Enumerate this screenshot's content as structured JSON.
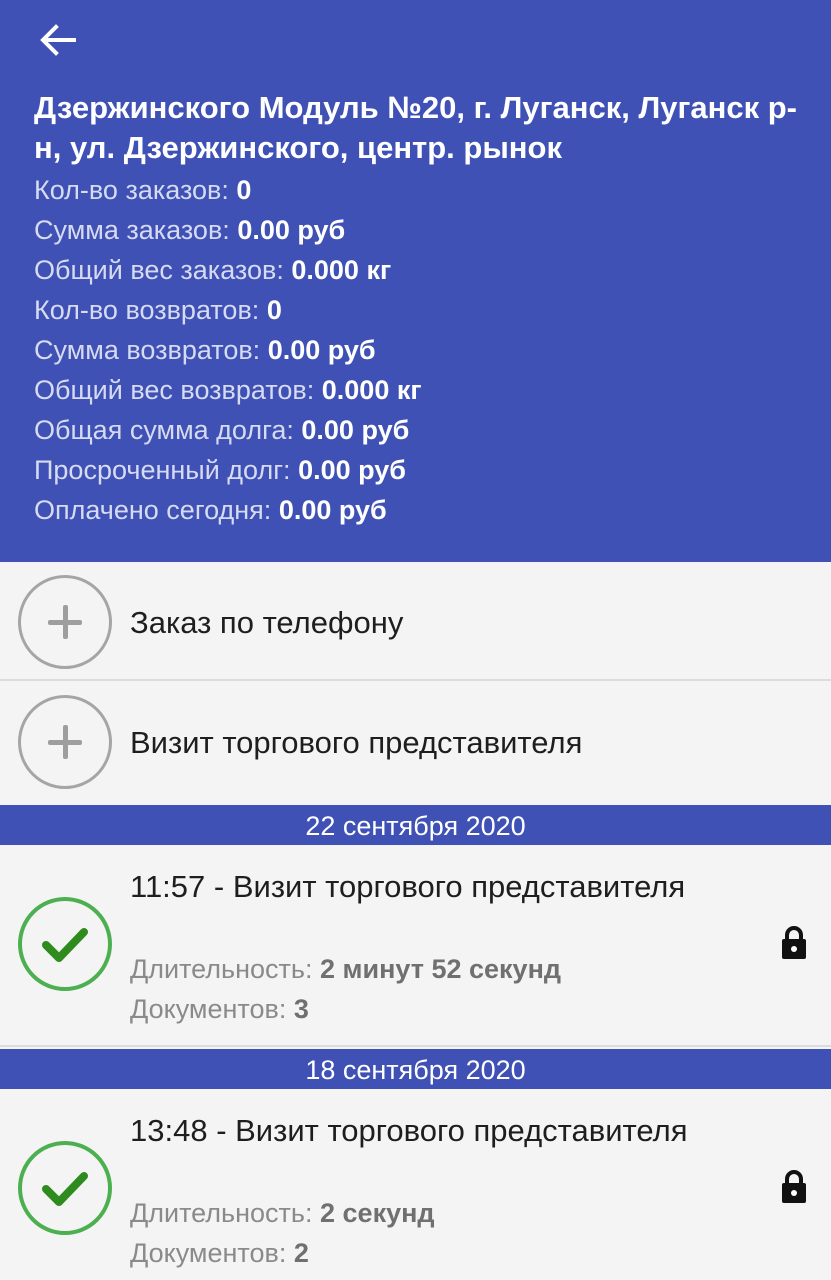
{
  "header": {
    "title": "Дзержинского Модуль №20, г. Луганск, Луганск р-н, ул. Дзержинского, центр. рынок",
    "stats": [
      {
        "label": "Кол-во заказов:",
        "value": "0"
      },
      {
        "label": "Сумма заказов:",
        "value": "0.00 руб"
      },
      {
        "label": "Общий вес заказов:",
        "value": "0.000 кг"
      },
      {
        "label": "Кол-во возвратов:",
        "value": "0"
      },
      {
        "label": "Сумма возвратов:",
        "value": "0.00 руб"
      },
      {
        "label": "Общий вес возвратов:",
        "value": "0.000 кг"
      },
      {
        "label": "Общая сумма долга:",
        "value": "0.00 руб"
      },
      {
        "label": "Просроченный долг:",
        "value": "0.00 руб"
      },
      {
        "label": "Оплачено сегодня:",
        "value": "0.00 руб"
      }
    ]
  },
  "actions": [
    {
      "label": "Заказ по телефону",
      "icon": "plus-circle-icon"
    },
    {
      "label": "Визит торгового представителя",
      "icon": "plus-circle-icon"
    }
  ],
  "visits": [
    {
      "date": "22 сентября 2020",
      "title": "11:57 - Визит торгового представителя",
      "duration_label": "Длительность:",
      "duration": "2 минут 52 секунд",
      "docs_label": "Документов:",
      "docs": "3",
      "status_icon": "check-circle-icon",
      "lock_icon": "lock-icon"
    },
    {
      "date": "18 сентября 2020",
      "title": "13:48 - Визит торгового представителя",
      "duration_label": "Длительность:",
      "duration": "2 секунд",
      "docs_label": "Документов:",
      "docs": "2",
      "status_icon": "check-circle-icon",
      "lock_icon": "lock-icon"
    }
  ],
  "colors": {
    "primary": "#3f51b5",
    "success": "#4caf50",
    "background": "#f4f4f4"
  }
}
